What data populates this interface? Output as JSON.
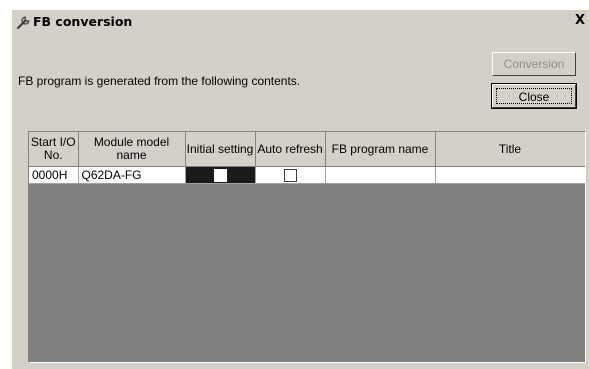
{
  "window": {
    "title": "FB conversion",
    "close_glyph": "X"
  },
  "message": "FB program is generated from the following contents.",
  "buttons": {
    "conversion": "Conversion",
    "close": "Close"
  },
  "table": {
    "headers": [
      "Start I/O No.",
      "Module model name",
      "Initial setting",
      "Auto refresh",
      "FB program name",
      "Title"
    ],
    "rows": [
      {
        "start_io": "0000H",
        "module_model": "Q62DA-FG",
        "initial_setting": false,
        "auto_refresh": false,
        "fb_program_name": "",
        "title": ""
      }
    ]
  },
  "icons": {
    "title": "wrench-icon"
  },
  "colors": {
    "dialog_bg": "#d4d0c8",
    "grid_empty": "#808080",
    "selected_cell": "#1a1a1a"
  }
}
